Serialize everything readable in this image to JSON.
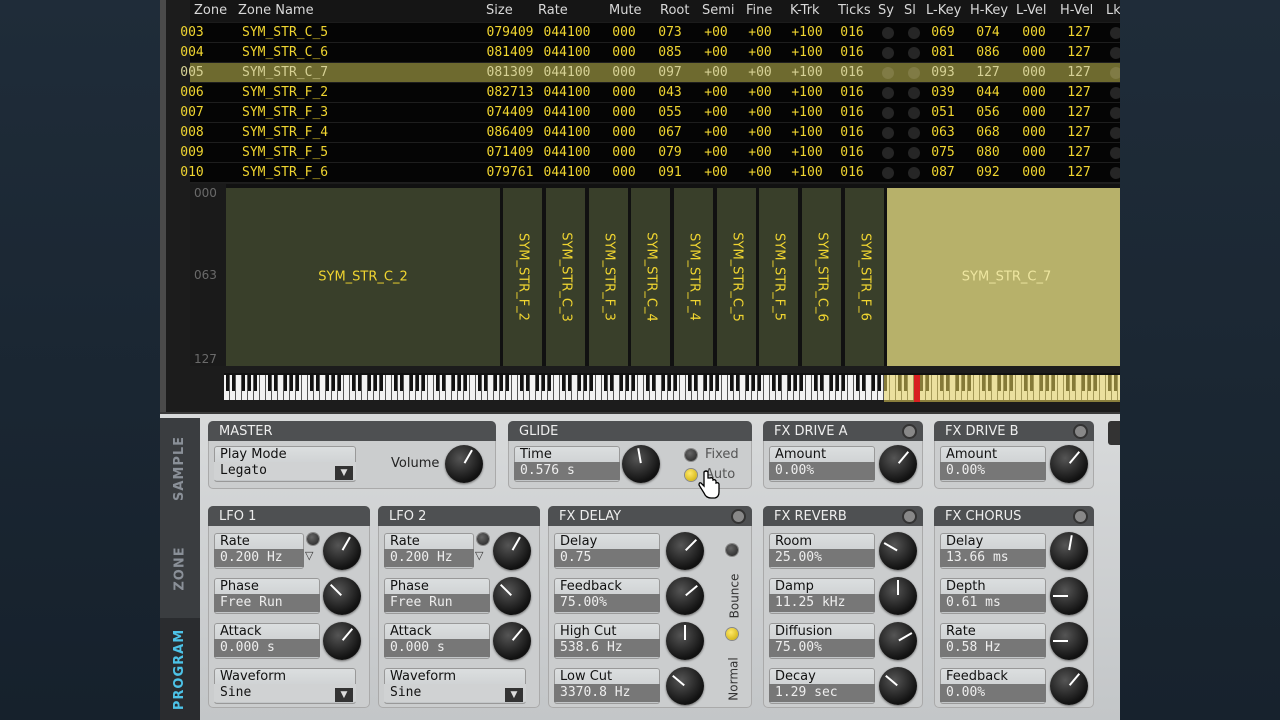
{
  "zone_table": {
    "columns": [
      "Zone",
      "Zone Name",
      "Size",
      "Rate",
      "Mute",
      "Root",
      "Semi",
      "Fine",
      "K-Trk",
      "Ticks",
      "Sy",
      "Sl",
      "L-Key",
      "H-Key",
      "L-Vel",
      "H-Vel",
      "Lk"
    ],
    "rows": [
      [
        "003",
        "SYM_STR_C_5",
        "079409",
        "044100",
        "000",
        "073",
        "+00",
        "+00",
        "+100",
        "016",
        "069",
        "074",
        "000",
        "127"
      ],
      [
        "004",
        "SYM_STR_C_6",
        "081409",
        "044100",
        "000",
        "085",
        "+00",
        "+00",
        "+100",
        "016",
        "081",
        "086",
        "000",
        "127"
      ],
      [
        "005",
        "SYM_STR_C_7",
        "081309",
        "044100",
        "000",
        "097",
        "+00",
        "+00",
        "+100",
        "016",
        "093",
        "127",
        "000",
        "127"
      ],
      [
        "006",
        "SYM_STR_F_2",
        "082713",
        "044100",
        "000",
        "043",
        "+00",
        "+00",
        "+100",
        "016",
        "039",
        "044",
        "000",
        "127"
      ],
      [
        "007",
        "SYM_STR_F_3",
        "074409",
        "044100",
        "000",
        "055",
        "+00",
        "+00",
        "+100",
        "016",
        "051",
        "056",
        "000",
        "127"
      ],
      [
        "008",
        "SYM_STR_F_4",
        "086409",
        "044100",
        "000",
        "067",
        "+00",
        "+00",
        "+100",
        "016",
        "063",
        "068",
        "000",
        "127"
      ],
      [
        "009",
        "SYM_STR_F_5",
        "071409",
        "044100",
        "000",
        "079",
        "+00",
        "+00",
        "+100",
        "016",
        "075",
        "080",
        "000",
        "127"
      ],
      [
        "010",
        "SYM_STR_F_6",
        "079761",
        "044100",
        "000",
        "091",
        "+00",
        "+00",
        "+100",
        "016",
        "087",
        "092",
        "000",
        "127"
      ]
    ],
    "selected_index": 2
  },
  "key_map": {
    "velocity_labels": [
      "000",
      "063",
      "127"
    ],
    "zones": [
      "SYM_STR_C_2",
      "SYM_STR_F_2",
      "SYM_STR_C_3",
      "SYM_STR_F_3",
      "SYM_STR_C_4",
      "SYM_STR_F_4",
      "SYM_STR_C_5",
      "SYM_STR_F_5",
      "SYM_STR_C_6",
      "SYM_STR_F_6",
      "SYM_STR_C_7"
    ]
  },
  "tabs": {
    "sample": "SAMPLE",
    "zone": "ZONE",
    "program": "PROGRAM",
    "active": "PROGRAM"
  },
  "master": {
    "title": "MASTER",
    "play_mode_label": "Play Mode",
    "play_mode_value": "Legato",
    "volume_label": "Volume"
  },
  "glide": {
    "title": "GLIDE",
    "time_label": "Time",
    "time_value": "0.576 s",
    "fixed_label": "Fixed",
    "auto_label": "Auto"
  },
  "fx_drive_a": {
    "title": "FX DRIVE A",
    "amount_label": "Amount",
    "amount_value": "0.00%"
  },
  "fx_drive_b": {
    "title": "FX DRIVE B",
    "amount_label": "Amount",
    "amount_value": "0.00%"
  },
  "lfo1": {
    "title": "LFO 1",
    "rate_label": "Rate",
    "rate_value": "0.200 Hz",
    "phase_label": "Phase",
    "phase_value": "Free Run",
    "attack_label": "Attack",
    "attack_value": "0.000 s",
    "waveform_label": "Waveform",
    "waveform_value": "Sine"
  },
  "lfo2": {
    "title": "LFO 2",
    "rate_label": "Rate",
    "rate_value": "0.200 Hz",
    "phase_label": "Phase",
    "phase_value": "Free Run",
    "attack_label": "Attack",
    "attack_value": "0.000 s",
    "waveform_label": "Waveform",
    "waveform_value": "Sine"
  },
  "fx_delay": {
    "title": "FX DELAY",
    "delay_label": "Delay",
    "delay_value": "0.75",
    "feedback_label": "Feedback",
    "feedback_value": "75.00%",
    "highcut_label": "High Cut",
    "highcut_value": "538.6 Hz",
    "lowcut_label": "Low Cut",
    "lowcut_value": "3370.8 Hz",
    "bounce_label": "Bounce",
    "normal_label": "Normal"
  },
  "fx_reverb": {
    "title": "FX REVERB",
    "room_label": "Room",
    "room_value": "25.00%",
    "damp_label": "Damp",
    "damp_value": "11.25 kHz",
    "diffusion_label": "Diffusion",
    "diffusion_value": "75.00%",
    "decay_label": "Decay",
    "decay_value": "1.29 sec"
  },
  "fx_chorus": {
    "title": "FX CHORUS",
    "delay_label": "Delay",
    "delay_value": "13.66 ms",
    "depth_label": "Depth",
    "depth_value": "0.61 ms",
    "rate_label": "Rate",
    "rate_value": "0.58 Hz",
    "feedback_label": "Feedback",
    "feedback_value": "0.00%"
  },
  "colors": {
    "table_text": "#f0d530",
    "selected_row": "#6e6a2f",
    "active_tab": "#4dc3e8",
    "led_on": "#ffe96a"
  }
}
